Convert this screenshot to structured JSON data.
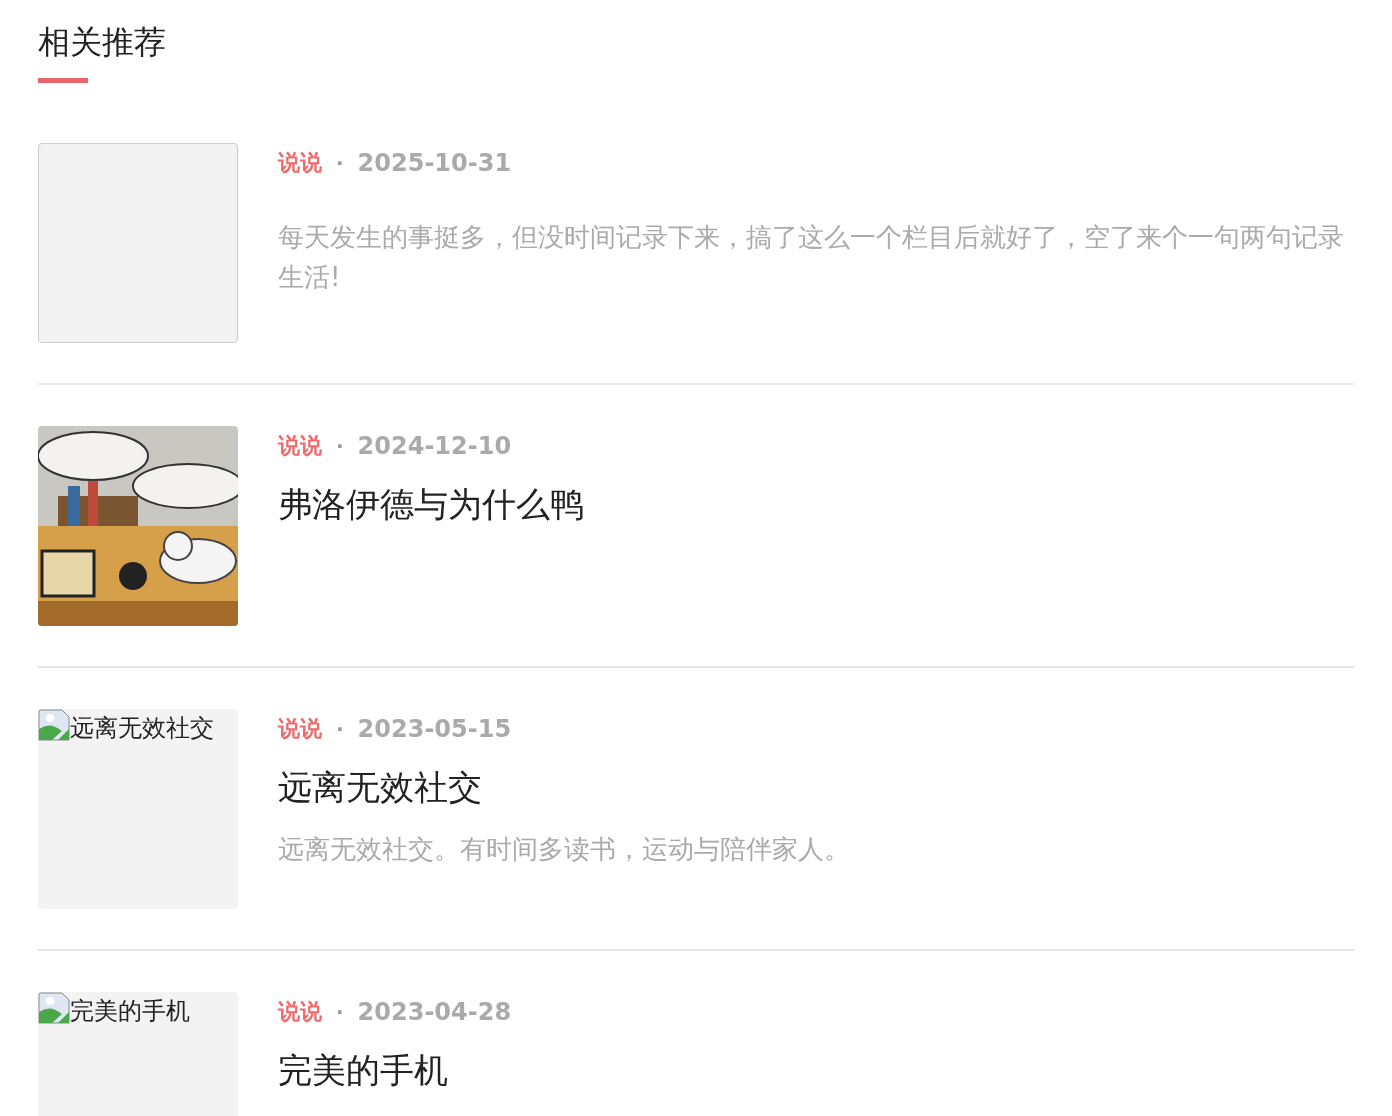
{
  "section": {
    "title": "相关推荐"
  },
  "posts": [
    {
      "thumbnail": {
        "kind": "empty"
      },
      "category": "说说",
      "separator": "·",
      "date": "2025-10-31",
      "excerpt": "每天发生的事挺多，但没时间记录下来，搞了这么一个栏目后就好了，空了来个一句两句记录生活!"
    },
    {
      "category": "说说",
      "separator": "·",
      "date": "2024-12-10",
      "title": "弗洛伊德与为什么鸭"
    },
    {
      "thumbnail": {
        "kind": "broken",
        "alt": "远离无效社交"
      },
      "category": "说说",
      "separator": "·",
      "date": "2023-05-15",
      "title": "远离无效社交",
      "excerpt": "远离无效社交。有时间多读书，运动与陪伴家人。"
    },
    {
      "thumbnail": {
        "kind": "broken",
        "alt": "完美的手机"
      },
      "category": "说说",
      "separator": "·",
      "date": "2023-04-28",
      "title": "完美的手机"
    }
  ]
}
